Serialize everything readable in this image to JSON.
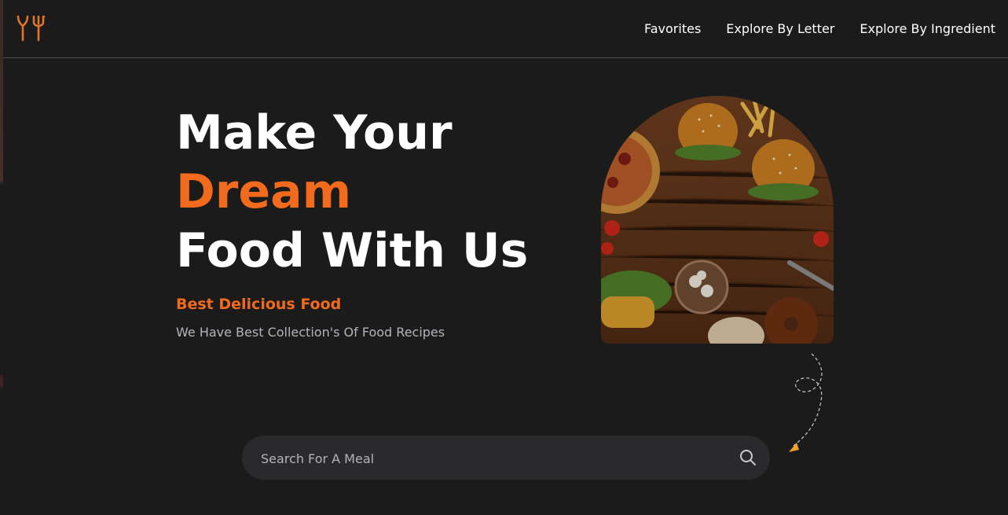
{
  "nav": {
    "items": [
      {
        "label": "Favorites"
      },
      {
        "label": "Explore By Letter"
      },
      {
        "label": "Explore By Ingredient"
      }
    ]
  },
  "hero": {
    "title_line1": "Make Your",
    "title_line2": "Dream",
    "title_line3": "Food With Us",
    "subtitle": "Best Delicious Food",
    "description": "We Have Best Collection's Of Food Recipes"
  },
  "search": {
    "placeholder": "Search For A Meal",
    "value": ""
  },
  "icons": {
    "logo": "fork-knife-logo-icon",
    "search": "search-icon",
    "arrow": "dashed-arrow-icon"
  },
  "colors": {
    "accent": "#f26b1d",
    "background": "#1c1b1c",
    "search_bg": "#2a2a2c",
    "muted_text": "#b3b4bb"
  }
}
